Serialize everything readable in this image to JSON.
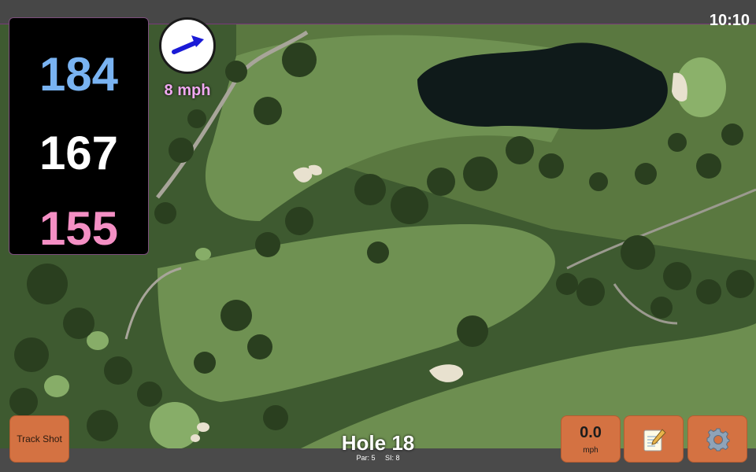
{
  "status": {
    "time": "10:10"
  },
  "distances": {
    "back": "184",
    "middle": "167",
    "front": "155"
  },
  "wind": {
    "speed": "8 mph",
    "icon": "wind-direction-arrow-icon"
  },
  "hole": {
    "title": "Hole 18",
    "par": "Par: 5",
    "si": "SI: 8"
  },
  "buttons": {
    "track_shot": "Track Shot",
    "speed_value": "0.0",
    "speed_unit": "mph",
    "notes_icon": "notepad-icon",
    "settings_icon": "gear-icon"
  },
  "colors": {
    "back": "#79b3f2",
    "middle": "#ffffff",
    "front": "#f48fc4",
    "wind_text": "#f0a8f0",
    "button": "#d47242"
  }
}
